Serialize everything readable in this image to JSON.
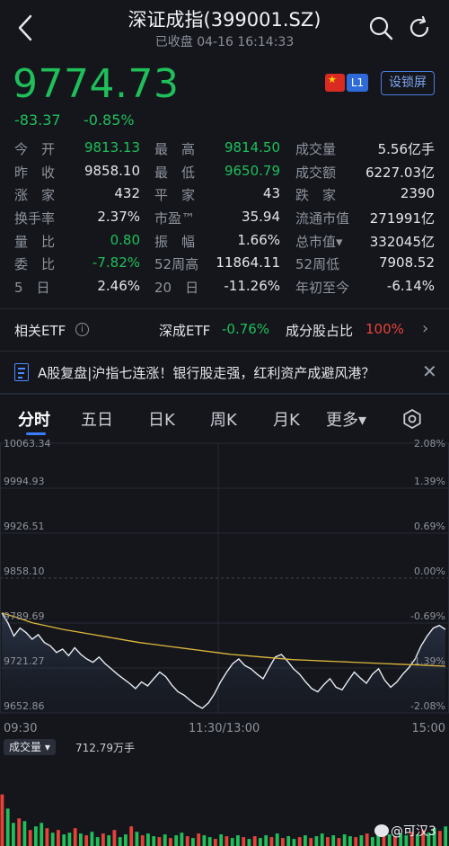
{
  "header": {
    "title": "深证成指(399001.SZ)",
    "subtitle": "已收盘 04-16 16:14:33"
  },
  "quote": {
    "price": "9774.73",
    "change": "-83.37",
    "change_pct": "-0.85%",
    "level_badge": "L1",
    "lock_button": "设锁屏",
    "colors": {
      "down": "#1fbf5a",
      "up": "#e8413a",
      "accent": "#3a7bff"
    }
  },
  "stats": [
    [
      {
        "label": "今　开",
        "value": "9813.13",
        "color": "down"
      },
      {
        "label": "最　高",
        "value": "9814.50",
        "color": "down"
      },
      {
        "label": "成交量",
        "value": "5.56亿手"
      }
    ],
    [
      {
        "label": "昨　收",
        "value": "9858.10"
      },
      {
        "label": "最　低",
        "value": "9650.79",
        "color": "down"
      },
      {
        "label": "成交额",
        "value": "6227.03亿"
      }
    ],
    [
      {
        "label": "涨　家",
        "value": "432"
      },
      {
        "label": "平　家",
        "value": "43"
      },
      {
        "label": "跌　家",
        "value": "2390"
      }
    ],
    [
      {
        "label": "换手率",
        "value": "2.37%"
      },
      {
        "label": "市盈™",
        "value": "35.94"
      },
      {
        "label": "流通市值",
        "value": "271991亿"
      }
    ],
    [
      {
        "label": "量　比",
        "value": "0.80",
        "color": "down"
      },
      {
        "label": "振　幅",
        "value": "1.66%"
      },
      {
        "label": "总市值▾",
        "value": "332045亿"
      }
    ],
    [
      {
        "label": "委　比",
        "value": "-7.82%",
        "color": "down"
      },
      {
        "label": "52周高",
        "value": "11864.11"
      },
      {
        "label": "52周低",
        "value": "7908.52"
      }
    ],
    [
      {
        "label": "5　日",
        "value": "2.46%"
      },
      {
        "label": "20　日",
        "value": "-11.26%"
      },
      {
        "label": "年初至今",
        "value": "-6.14%"
      }
    ]
  ],
  "etf": {
    "label": "相关ETF",
    "info_icon": "i",
    "name": "深成ETF",
    "change": "-0.76%",
    "component_label": "成分股占比",
    "component_value": "100%",
    "arrow": "›"
  },
  "news": {
    "text": "A股复盘|沪指七连涨！银行股走强，红利资产成避风港？",
    "close": "✕"
  },
  "tabs": [
    "分时",
    "五日",
    "日K",
    "周K",
    "月K",
    "更多▾"
  ],
  "chart_data": {
    "type": "line",
    "title": "",
    "y_ticks": [
      "10063.34",
      "9994.93",
      "9926.51",
      "9858.10",
      "9789.69",
      "9721.27",
      "9652.86"
    ],
    "pct_ticks": [
      "2.08%",
      "1.39%",
      "0.69%",
      "0.00%",
      "-0.69%",
      "-1.39%",
      "-2.08%"
    ],
    "x_ticks": [
      "09:30",
      "11:30/13:00",
      "15:00"
    ],
    "ylim": [
      9652.86,
      10063.34
    ],
    "prev_close": 9858.1,
    "series": [
      {
        "values": [
          9805,
          9790,
          9770,
          9782,
          9775,
          9765,
          9772,
          9760,
          9755,
          9745,
          9750,
          9740,
          9752,
          9742,
          9735,
          9730,
          9738,
          9728,
          9720,
          9712,
          9705,
          9698,
          9690,
          9700,
          9694,
          9705,
          9715,
          9708,
          9695,
          9685,
          9680,
          9672,
          9665,
          9660,
          9668,
          9682,
          9700,
          9715,
          9728,
          9735,
          9725,
          9720,
          9712,
          9705,
          9722,
          9738,
          9742,
          9732,
          9720,
          9712,
          9700,
          9690,
          9685,
          9696,
          9705,
          9692,
          9688,
          9702,
          9715,
          9706,
          9698,
          9712,
          9720,
          9703,
          9692,
          9700,
          9712,
          9722,
          9735,
          9755,
          9770,
          9782,
          9786,
          9780
        ]
      },
      {
        "values": [
          9805,
          9798,
          9790,
          9785,
          9780,
          9776,
          9772,
          9768,
          9764,
          9760,
          9757,
          9754,
          9751,
          9748,
          9745,
          9742,
          9740,
          9738,
          9736,
          9734,
          9733,
          9732,
          9731,
          9730,
          9729,
          9728,
          9727,
          9726,
          9725,
          9724
        ]
      }
    ]
  },
  "volume": {
    "button": "成交量 ▾",
    "value": "712.79万手",
    "bars": [
      0.58,
      0.42,
      0.26,
      0.31,
      0.28,
      0.18,
      0.22,
      0.26,
      0.2,
      0.15,
      0.18,
      0.13,
      0.15,
      0.2,
      0.14,
      0.12,
      0.16,
      0.1,
      0.14,
      0.12,
      0.18,
      0.1,
      0.13,
      0.22,
      0.16,
      0.12,
      0.14,
      0.11,
      0.1,
      0.13,
      0.09,
      0.12,
      0.15,
      0.11,
      0.09,
      0.14,
      0.12,
      0.1,
      0.08,
      0.13,
      0.11,
      0.09,
      0.12,
      0.1,
      0.08,
      0.11,
      0.09,
      0.12,
      0.1,
      0.14,
      0.09,
      0.11,
      0.08,
      0.1,
      0.12,
      0.09,
      0.11,
      0.14,
      0.1,
      0.12,
      0.09,
      0.13,
      0.11,
      0.1,
      0.12,
      0.14,
      0.1,
      0.12,
      0.15,
      0.13,
      0.11,
      0.14,
      0.12,
      0.16,
      0.13,
      0.18,
      0.15,
      0.2,
      0.17,
      0.22
    ]
  },
  "watermark": "@可汉3"
}
